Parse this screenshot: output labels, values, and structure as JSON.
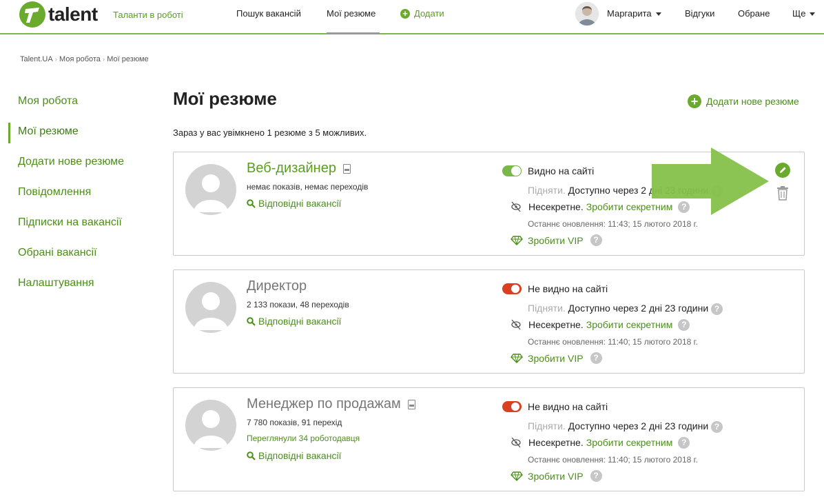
{
  "header": {
    "logo_text": "talent",
    "tagline": "Таланти в роботі",
    "nav": {
      "search_jobs": "Пошук вакансій",
      "my_resumes": "Мої резюме",
      "add": "Додати",
      "responses": "Відгуки",
      "favorites": "Обране",
      "more": "Ще"
    },
    "user_name": "Маргарита"
  },
  "breadcrumb": [
    "Talent.UA",
    "Моя робота",
    "Мої резюме"
  ],
  "sidebar": {
    "items": [
      {
        "label": "Моя робота"
      },
      {
        "label": "Мої резюме"
      },
      {
        "label": "Додати нове резюме"
      },
      {
        "label": "Повідомлення"
      },
      {
        "label": "Підписки на вакансії"
      },
      {
        "label": "Обрані вакансії"
      },
      {
        "label": "Налаштування"
      }
    ]
  },
  "main": {
    "title": "Мої резюме",
    "add_resume_label": "Додати нове резюме",
    "summary": "Зараз у вас увімкнено 1 резюме з 5 можливих."
  },
  "common": {
    "matching_jobs": "Відповідні вакансії",
    "raise_label": "Підняти.",
    "raise_available": "Доступно через 2 дні 23 години",
    "not_secret": "Несекретне.",
    "make_secret": "Зробити секретним",
    "make_vip": "Зробити VIP",
    "help": "?"
  },
  "resumes": [
    {
      "title": "Веб-дизайнер",
      "stats": "немає показів, немає переходів",
      "viewed": "",
      "visible": true,
      "visibility_label": "Видно на сайті",
      "updated": "Останнє оновлення: 11:43; 15 лютого 2018 г."
    },
    {
      "title": "Директор",
      "stats": "2 133 покази, 48 переходів",
      "viewed": "",
      "visible": false,
      "visibility_label": "Не видно на сайті",
      "updated": "Останнє оновлення: 11:40; 15 лютого 2018 г."
    },
    {
      "title": "Менеджер по продажам",
      "stats": "7 780 показів, 91 перехід",
      "viewed": "Переглянули 34 роботодавця",
      "visible": false,
      "visibility_label": "Не видно на сайті",
      "updated": "Останнє оновлення: 11:40; 15 лютого 2018 г."
    }
  ],
  "colors": {
    "brand_green": "#6aab2e",
    "link_green": "#4a8f17",
    "off_red": "#d8401f",
    "arrow_green": "#86c14a"
  }
}
